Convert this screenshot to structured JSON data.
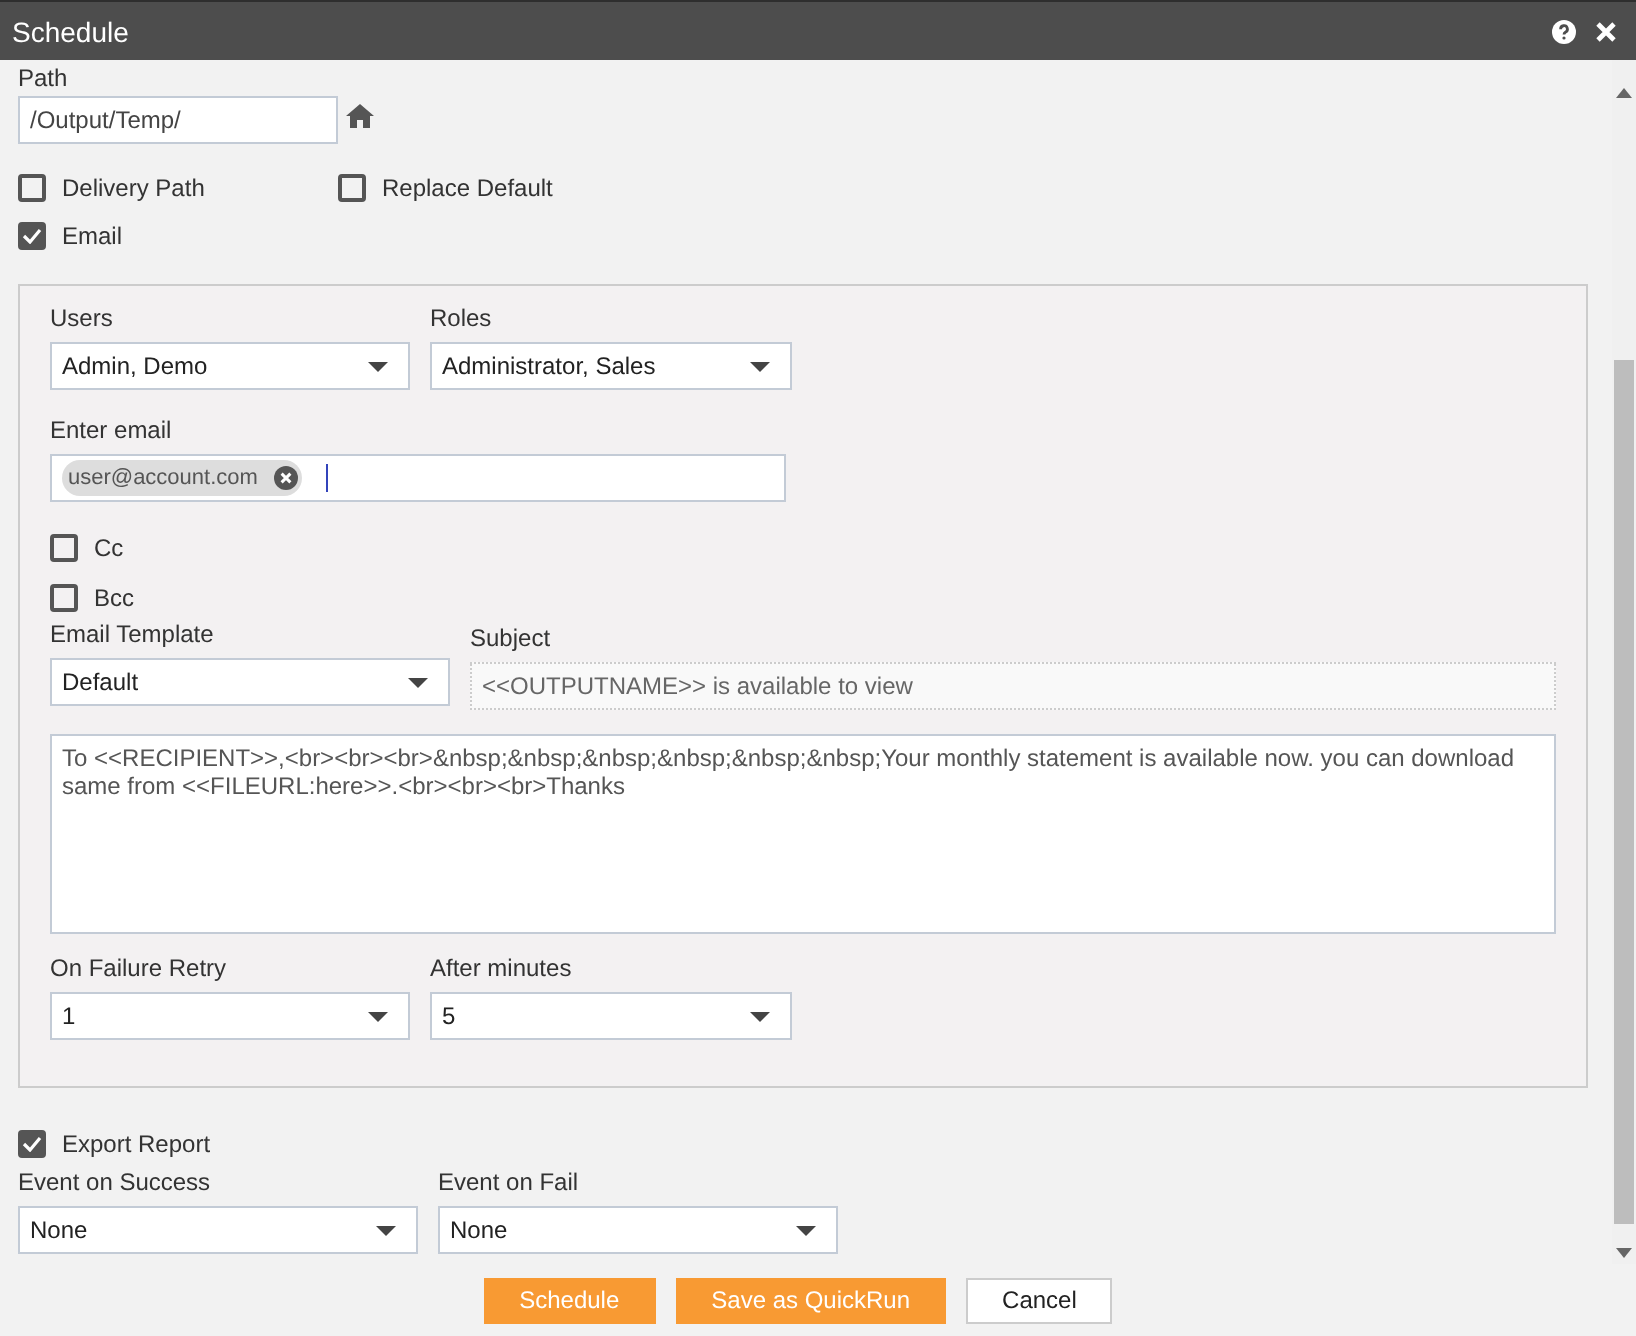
{
  "window": {
    "title": "Schedule"
  },
  "path": {
    "label": "Path",
    "value": "/Output/Temp/"
  },
  "options": [
    {
      "label": "Delivery Path",
      "checked": false
    },
    {
      "label": "Replace Default",
      "checked": false
    },
    {
      "label": "Email",
      "checked": true
    }
  ],
  "email": {
    "users": {
      "label": "Users",
      "value": "Admin, Demo"
    },
    "roles": {
      "label": "Roles",
      "value": "Administrator, Sales"
    },
    "enter_email": {
      "label": "Enter email",
      "tags": [
        "user@account.com"
      ]
    },
    "copies": [
      {
        "label": "Cc",
        "checked": false
      },
      {
        "label": "Bcc",
        "checked": false
      }
    ],
    "template": {
      "label": "Email Template",
      "value": "Default"
    },
    "subject": {
      "label": "Subject",
      "value": "<<OUTPUTNAME>> is available to view"
    },
    "body": "To <<RECIPIENT>>,<br><br><br>&nbsp;&nbsp;&nbsp;&nbsp;&nbsp;&nbsp;Your monthly statement is available now. you can download same from <<FILEURL:here>>.<br><br><br>Thanks",
    "retry": {
      "label": "On Failure Retry",
      "value": "1"
    },
    "after": {
      "label": "After minutes",
      "value": "5"
    }
  },
  "export_report": {
    "label": "Export Report",
    "checked": true
  },
  "events": [
    {
      "label": "Event on Success",
      "value": "None"
    },
    {
      "label": "Event on Fail",
      "value": "None"
    }
  ],
  "buttons": [
    {
      "label": "Schedule",
      "kind": "primary"
    },
    {
      "label": "Save as QuickRun",
      "kind": "primary"
    },
    {
      "label": "Cancel",
      "kind": "secondary"
    }
  ]
}
